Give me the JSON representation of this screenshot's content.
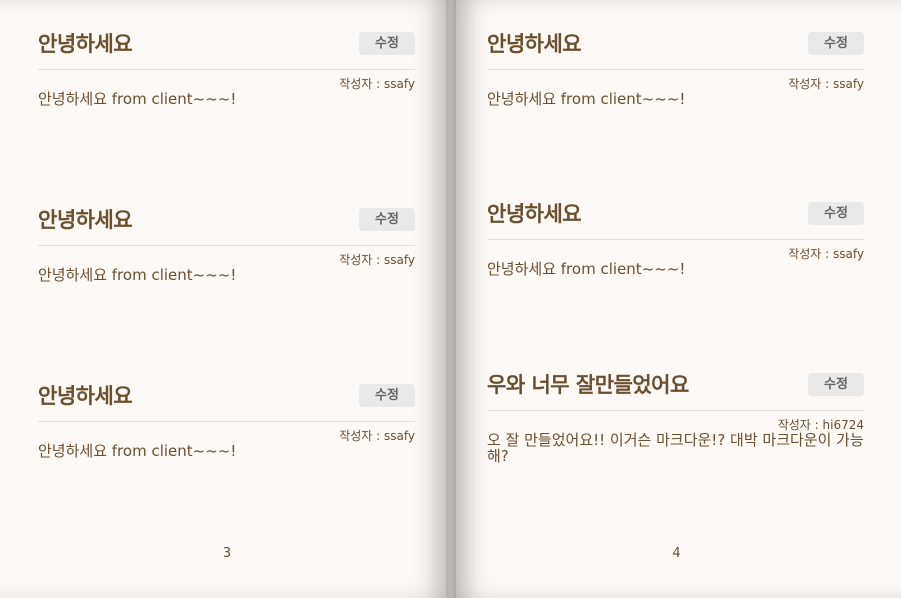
{
  "edit_label": "수정",
  "author_prefix": "작성자 : ",
  "left_page": {
    "page_number": "3",
    "posts": [
      {
        "title": "안녕하세요",
        "author": "ssafy",
        "body": "안녕하세요 from client~~~!"
      },
      {
        "title": "안녕하세요",
        "author": "ssafy",
        "body": "안녕하세요 from client~~~!"
      },
      {
        "title": "안녕하세요",
        "author": "ssafy",
        "body": "안녕하세요 from client~~~!"
      }
    ]
  },
  "right_page": {
    "page_number": "4",
    "posts": [
      {
        "title": "안녕하세요",
        "author": "ssafy",
        "body": "안녕하세요 from client~~~!"
      },
      {
        "title": "안녕하세요",
        "author": "ssafy",
        "body": "안녕하세요 from client~~~!"
      },
      {
        "title": "우와 너무 잘만들었어요",
        "author": "hi6724",
        "body": "오 잘 만들었어요!! 이거슨 마크다운!? 대박 마크다운이 가능해?"
      }
    ]
  }
}
